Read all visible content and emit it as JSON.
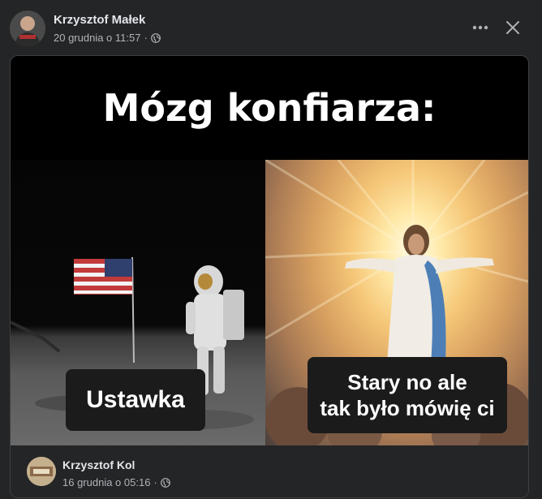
{
  "post": {
    "author": "Krzysztof Małek",
    "timestamp": "20 grudnia o 11:57",
    "separator": "·",
    "privacy_icon": "globe-icon",
    "more_icon": "more-options-icon",
    "close_icon": "close-icon"
  },
  "meme": {
    "title": "Mózg konfiarza:",
    "left_caption": "Ustawka",
    "right_caption_line1": "Stary no ale",
    "right_caption_line2": "tak było mówię ci"
  },
  "shared_author": {
    "name": "Krzysztof Kol",
    "timestamp": "16 grudnia o 05:16",
    "separator": "·",
    "privacy_icon": "globe-icon"
  },
  "colors": {
    "background": "#242526",
    "text_primary": "#e4e6eb",
    "text_secondary": "#b0b3b8",
    "border": "#3e4042"
  }
}
